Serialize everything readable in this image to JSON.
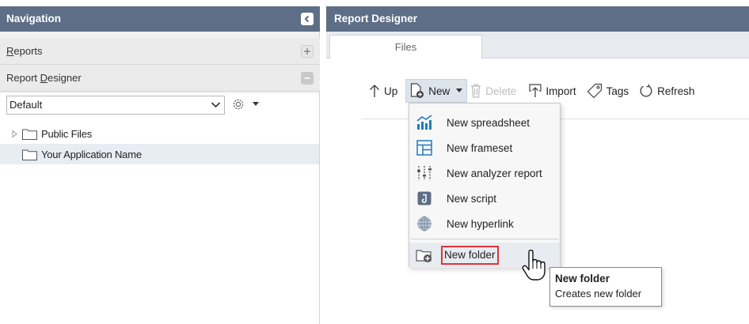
{
  "navigation": {
    "title": "Navigation",
    "sections": [
      {
        "label": "Reports",
        "underline_char": "R",
        "rest": "eports",
        "action": "+"
      },
      {
        "label": "Report Designer",
        "pre": "Report ",
        "underline_char": "D",
        "rest": "esigner",
        "action": "−"
      }
    ],
    "dropdown_value": "Default",
    "tree": [
      {
        "label": "Public Files",
        "expandable": true,
        "selected": false
      },
      {
        "label": "Your Application Name",
        "expandable": false,
        "selected": true
      }
    ]
  },
  "designer": {
    "title": "Report Designer",
    "tabs": [
      {
        "label": "Files",
        "active": true
      }
    ],
    "toolbar": {
      "up": "Up",
      "new": "New",
      "delete": "Delete",
      "import": "Import",
      "tags": "Tags",
      "refresh": "Refresh"
    },
    "new_menu": {
      "items": [
        {
          "label": "New spreadsheet",
          "icon": "spreadsheet-icon"
        },
        {
          "label": "New frameset",
          "icon": "frameset-icon"
        },
        {
          "label": "New analyzer report",
          "icon": "analyzer-icon"
        },
        {
          "label": "New script",
          "icon": "script-icon"
        },
        {
          "label": "New hyperlink",
          "icon": "globe-icon"
        }
      ],
      "folder_item": {
        "label": "New folder",
        "icon": "new-folder-icon"
      }
    },
    "tooltip": {
      "title": "New folder",
      "description": "Creates new folder"
    }
  },
  "colors": {
    "header_bg": "#5d6e86",
    "highlight_border": "#e0343a",
    "accent_blue": "#1e7bc1"
  }
}
